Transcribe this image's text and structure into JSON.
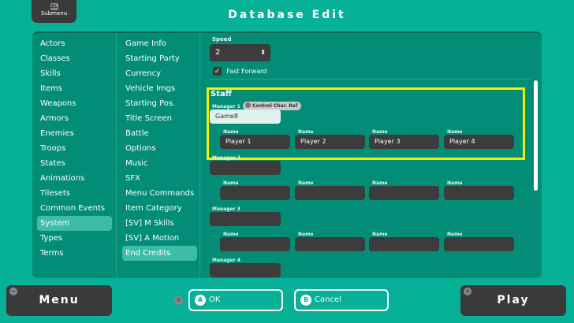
{
  "header": {
    "submenu_key": "ZL",
    "submenu_label": "Submenu",
    "title": "Database Edit"
  },
  "sidebar": {
    "items": [
      "Actors",
      "Classes",
      "Skills",
      "Items",
      "Weapons",
      "Armors",
      "Enemies",
      "Troops",
      "States",
      "Animations",
      "Tilesets",
      "Common Events",
      "System",
      "Types",
      "Terms"
    ],
    "selected": "System"
  },
  "subnav": {
    "items": [
      "Game Info",
      "Starting Party",
      "Currency",
      "Vehicle Imgs",
      "Starting Pos.",
      "Title Screen",
      "Battle",
      "Options",
      "Music",
      "SFX",
      "Menu Commands",
      "Item Category",
      "[SV] M Skills",
      "[SV] A Motion",
      "End Credits"
    ],
    "selected": "End Credits"
  },
  "content": {
    "speed_label": "Speed",
    "speed_value": "2",
    "fast_forward": "Fast Forward",
    "fast_forward_checked": true,
    "staff_title": "Staff",
    "control_char_ref": "Control Char. Ref",
    "name_label": "Name",
    "managers": [
      {
        "label": "Manager 1",
        "value": "Game8",
        "names": [
          "Player 1",
          "Player 2",
          "Player 3",
          "Player 4"
        ]
      },
      {
        "label": "Manager 2",
        "value": "",
        "names": [
          "",
          "",
          "",
          ""
        ]
      },
      {
        "label": "Manager 3",
        "value": "",
        "names": [
          "",
          "",
          "",
          ""
        ]
      },
      {
        "label": "Manager 4",
        "value": "",
        "names": []
      }
    ]
  },
  "footer": {
    "menu": "Menu",
    "menu_key": "−",
    "x_key": "X",
    "ok_key": "A",
    "ok": "OK",
    "cancel_key": "B",
    "cancel": "Cancel",
    "play": "Play",
    "play_key": "+"
  }
}
